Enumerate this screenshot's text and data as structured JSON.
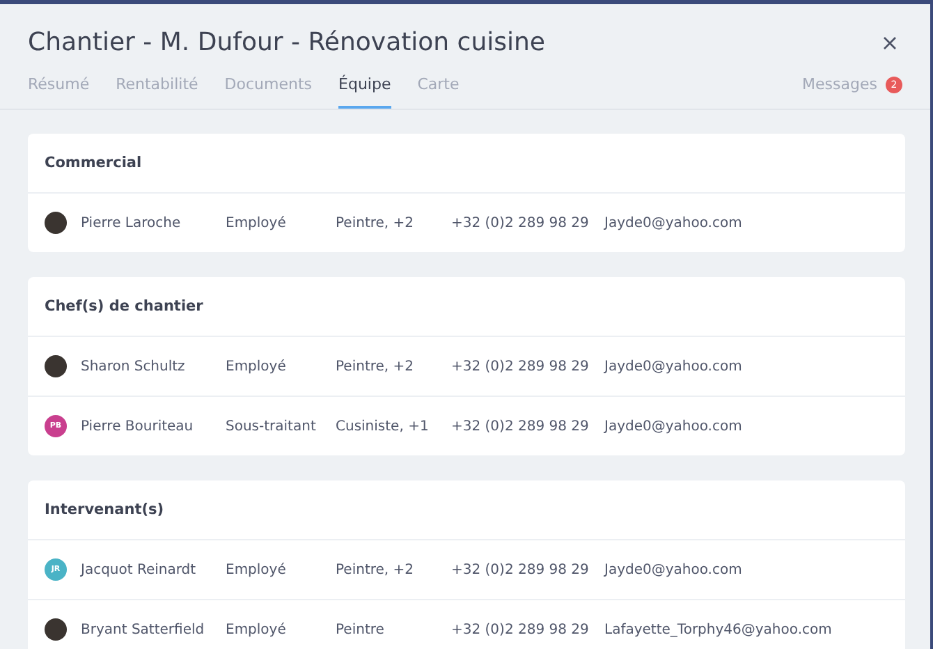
{
  "window": {
    "title": "Chantier - M. Dufour - Rénovation cuisine"
  },
  "tabs": [
    {
      "label": "Résumé",
      "selected": false
    },
    {
      "label": "Rentabilité",
      "selected": false
    },
    {
      "label": "Documents",
      "selected": false
    },
    {
      "label": "Équipe",
      "selected": true
    },
    {
      "label": "Carte",
      "selected": false
    }
  ],
  "messages": {
    "label": "Messages",
    "count": "2"
  },
  "sections": [
    {
      "title": "Commercial",
      "members": [
        {
          "avatar": {
            "kind": "photo"
          },
          "name": "Pierre Laroche",
          "status": "Employé",
          "trades": "Peintre, +2",
          "phone": "+32 (0)2 289 98 29",
          "email": "Jayde0@yahoo.com"
        }
      ]
    },
    {
      "title": "Chef(s) de chantier",
      "members": [
        {
          "avatar": {
            "kind": "photo"
          },
          "name": "Sharon Schultz",
          "status": "Employé",
          "trades": "Peintre, +2",
          "phone": "+32 (0)2 289 98 29",
          "email": "Jayde0@yahoo.com"
        },
        {
          "avatar": {
            "kind": "initials",
            "initials": "PB",
            "color": "#c93f8e"
          },
          "name": "Pierre Bouriteau",
          "status": "Sous-traitant",
          "trades": "Cusiniste, +1",
          "phone": "+32 (0)2 289 98 29",
          "email": "Jayde0@yahoo.com"
        }
      ]
    },
    {
      "title": "Intervenant(s)",
      "members": [
        {
          "avatar": {
            "kind": "initials",
            "initials": "JR",
            "color": "#4ab3c6"
          },
          "name": "Jacquot Reinardt",
          "status": "Employé",
          "trades": "Peintre, +2",
          "phone": "+32 (0)2 289 98 29",
          "email": "Jayde0@yahoo.com"
        },
        {
          "avatar": {
            "kind": "photo"
          },
          "name": "Bryant Satterfield",
          "status": "Employé",
          "trades": "Peintre",
          "phone": "+32 (0)2 289 98 29",
          "email": "Lafayette_Torphy46@yahoo.com"
        }
      ]
    }
  ]
}
